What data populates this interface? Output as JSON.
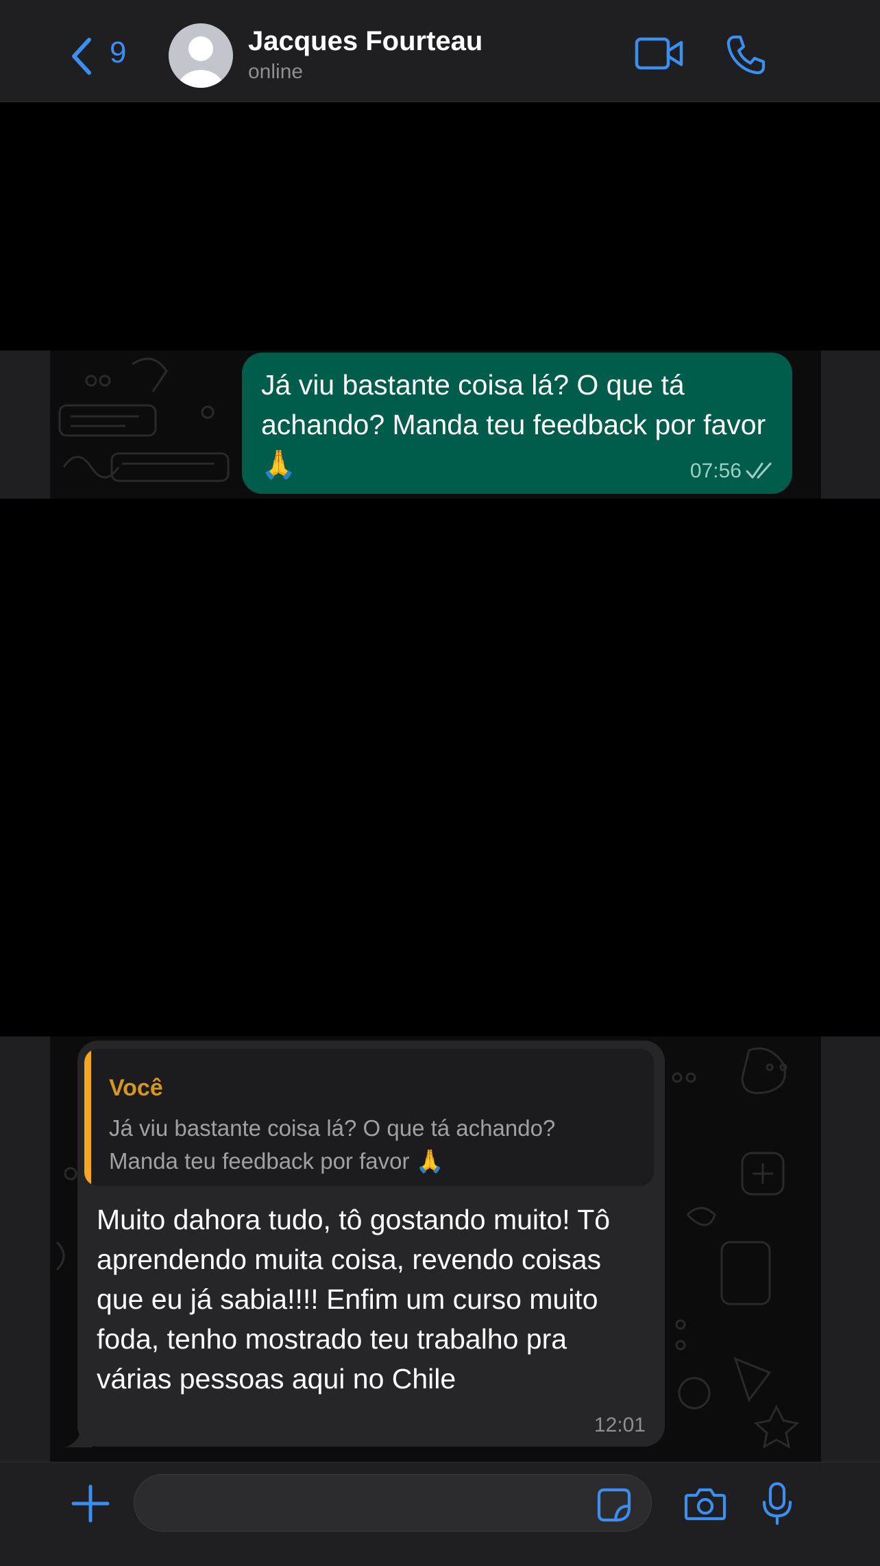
{
  "header": {
    "back_count": "9",
    "contact_name": "Jacques Fourteau",
    "contact_status": "online"
  },
  "messages": [
    {
      "direction": "outgoing",
      "text": "Já viu bastante coisa lá? O que tá achando? Manda teu feedback por favor 🙏",
      "time": "07:56",
      "status": "read"
    },
    {
      "direction": "incoming",
      "quote": {
        "author": "Você",
        "text": "Já viu bastante coisa lá? O que tá achando? Manda teu feedback por favor 🙏"
      },
      "text": "Muito dahora tudo, tô gostando muito! Tô aprendendo muita coisa, revendo coisas que eu já sabia!!!! Enfim um curso muito foda, tenho mostrado teu trabalho pra várias pessoas aqui no Chile",
      "time": "12:01"
    }
  ],
  "input": {
    "value": "",
    "placeholder": ""
  },
  "icons": {
    "back": "chevron-left-icon",
    "video": "video-camera-icon",
    "phone": "phone-icon",
    "attach": "plus-icon",
    "sticker": "sticker-icon",
    "camera": "camera-icon",
    "mic": "microphone-icon",
    "read_receipt": "double-check-icon"
  },
  "colors": {
    "accent": "#3b8ff0",
    "outgoing_bubble": "#005c4b",
    "incoming_bubble": "#262628",
    "quote_bar": "#f5a623",
    "quote_author": "#d4971f",
    "bar_background": "#1f1f21"
  }
}
